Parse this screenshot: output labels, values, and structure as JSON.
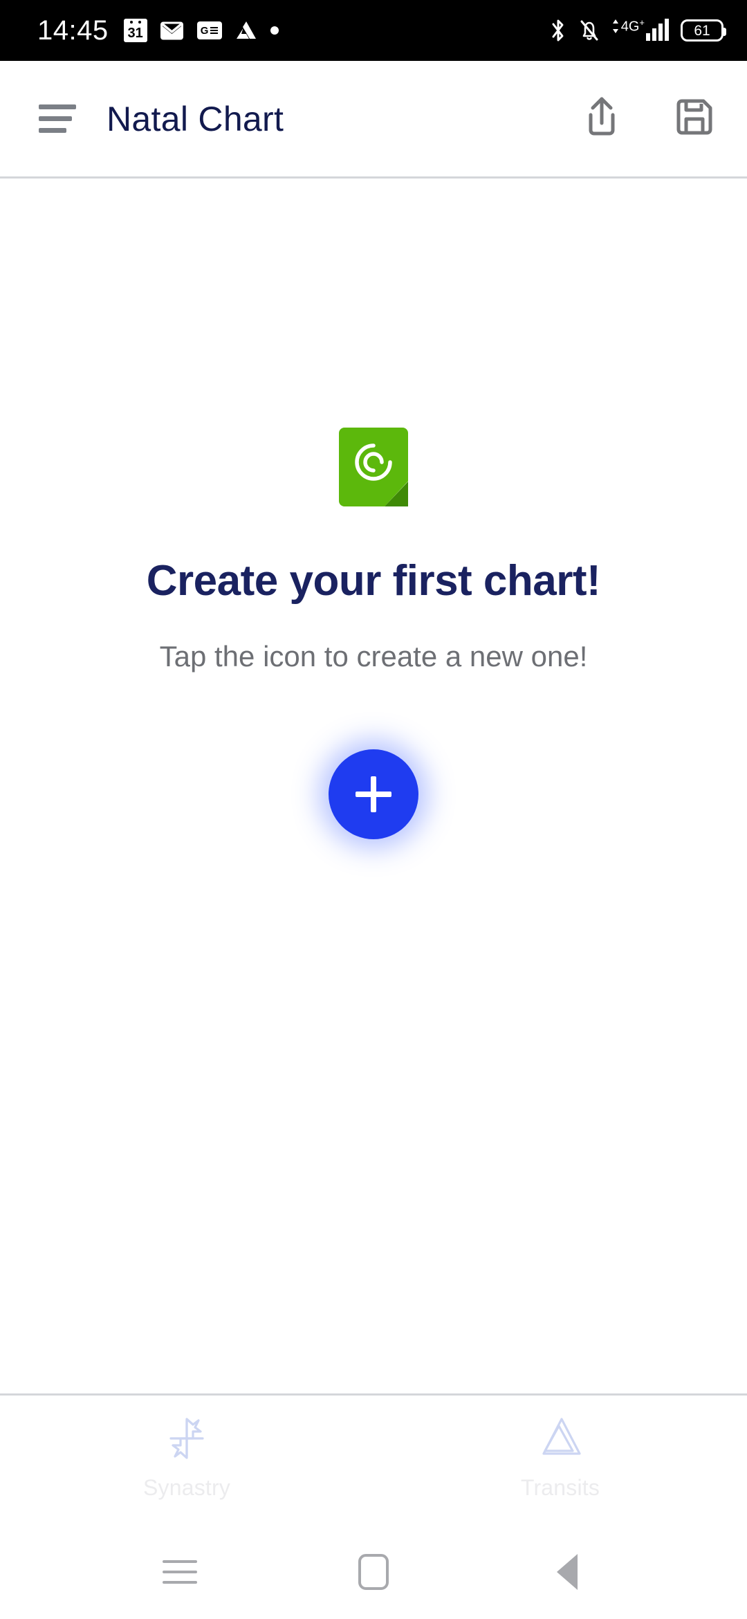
{
  "status_bar": {
    "time": "14:45",
    "left_icons": [
      {
        "name": "calendar-icon",
        "label": "31"
      },
      {
        "name": "gmail-icon",
        "label": "M"
      },
      {
        "name": "google-news-icon",
        "label": "G"
      },
      {
        "name": "google-drive-icon",
        "label": ""
      },
      {
        "name": "notification-dot-icon",
        "label": ""
      }
    ],
    "right_icons": [
      {
        "name": "bluetooth-icon"
      },
      {
        "name": "notifications-muted-icon"
      },
      {
        "name": "mobile-network-icon"
      }
    ],
    "network_label": "4G",
    "network_plus": "+",
    "battery_level": "61",
    "background_color": "#000000",
    "foreground_color": "#ffffff"
  },
  "app_bar": {
    "menu_icon": "hamburger-menu-icon",
    "title": "Natal Chart",
    "title_color": "#121a4e",
    "actions": [
      {
        "name": "share-export-icon",
        "label": "Export"
      },
      {
        "name": "save-icon",
        "label": "Save"
      }
    ]
  },
  "empty_state": {
    "icon_name": "green-chart-document-icon",
    "icon_color": "#5cb80c",
    "icon_fold_color": "#3f8a06",
    "headline": "Create your first chart!",
    "headline_color": "#1a2260",
    "subline": "Tap the icon to create a new one!",
    "subline_color": "#6d6f74"
  },
  "fab": {
    "label": "+",
    "name": "add-chart-fab",
    "color": "#1f3cf0",
    "icon_color": "#ffffff"
  },
  "bottom_nav": {
    "items": [
      {
        "label": "Synastry",
        "icon": "synastry-icon"
      },
      {
        "label": "Transits",
        "icon": "transits-icon"
      }
    ],
    "label_color": "#ececee",
    "icon_color": "#d2d9f5"
  },
  "android_nav": {
    "buttons": [
      {
        "name": "recents-button",
        "label": "Recents"
      },
      {
        "name": "home-button",
        "label": "Home"
      },
      {
        "name": "back-button",
        "label": "Back"
      }
    ],
    "color": "#a8a9ad"
  }
}
